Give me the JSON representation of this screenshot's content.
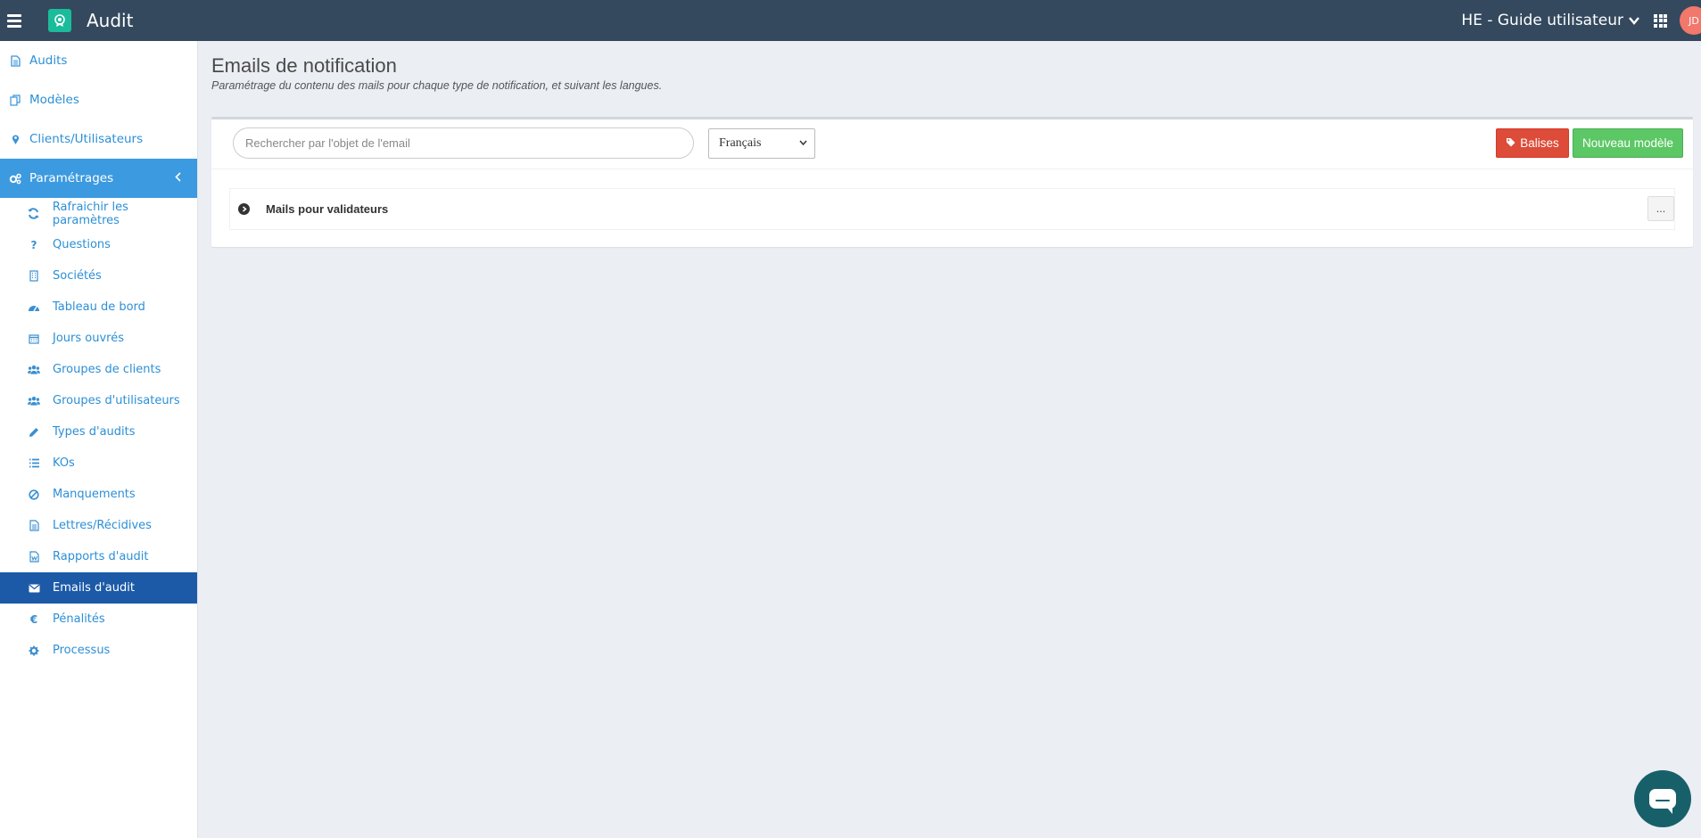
{
  "app": {
    "title": "Audit",
    "org_selector": "HE - Guide utilisateur",
    "avatar_initials": "JD"
  },
  "sidebar": {
    "items": [
      {
        "label": "Audits",
        "icon": "file-icon"
      },
      {
        "label": "Modèles",
        "icon": "copy-icon"
      },
      {
        "label": "Clients/Utilisateurs",
        "icon": "map-marker-icon"
      },
      {
        "label": "Paramétrages",
        "icon": "cogs-icon",
        "expanded": true
      }
    ],
    "subitems": [
      {
        "label": "Rafraichir les paramètres",
        "icon": "refresh-icon"
      },
      {
        "label": "Questions",
        "icon": "question-icon"
      },
      {
        "label": "Sociétés",
        "icon": "building-icon"
      },
      {
        "label": "Tableau de bord",
        "icon": "dashboard-icon"
      },
      {
        "label": "Jours ouvrés",
        "icon": "calendar-icon"
      },
      {
        "label": "Groupes de clients",
        "icon": "users-icon"
      },
      {
        "label": "Groupes d'utilisateurs",
        "icon": "users-icon"
      },
      {
        "label": "Types d'audits",
        "icon": "pencil-icon"
      },
      {
        "label": "KOs",
        "icon": "list-icon"
      },
      {
        "label": "Manquements",
        "icon": "ban-icon"
      },
      {
        "label": "Lettres/Récidives",
        "icon": "file-text-icon"
      },
      {
        "label": "Rapports d'audit",
        "icon": "file-word-icon"
      },
      {
        "label": "Emails d'audit",
        "icon": "envelope-icon",
        "active": true
      },
      {
        "label": "Pénalités",
        "icon": "euro-icon"
      },
      {
        "label": "Processus",
        "icon": "gear-icon"
      }
    ]
  },
  "main": {
    "title": "Emails de notification",
    "subtitle": "Paramétrage du contenu des mails pour chaque type de notification, et suivant les langues.",
    "search_placeholder": "Rechercher par l'objet de l'email",
    "language": "Français",
    "balises_label": "Balises",
    "new_model_label": "Nouveau modèle",
    "groups": [
      {
        "label": "Mails pour validateurs",
        "more_label": "..."
      }
    ]
  },
  "colors": {
    "topbar": "#34495e",
    "accent": "#3c9ae0",
    "active": "#1c5aa8",
    "danger": "#dd4b39",
    "success": "#5cc765",
    "chat": "#17606a"
  }
}
